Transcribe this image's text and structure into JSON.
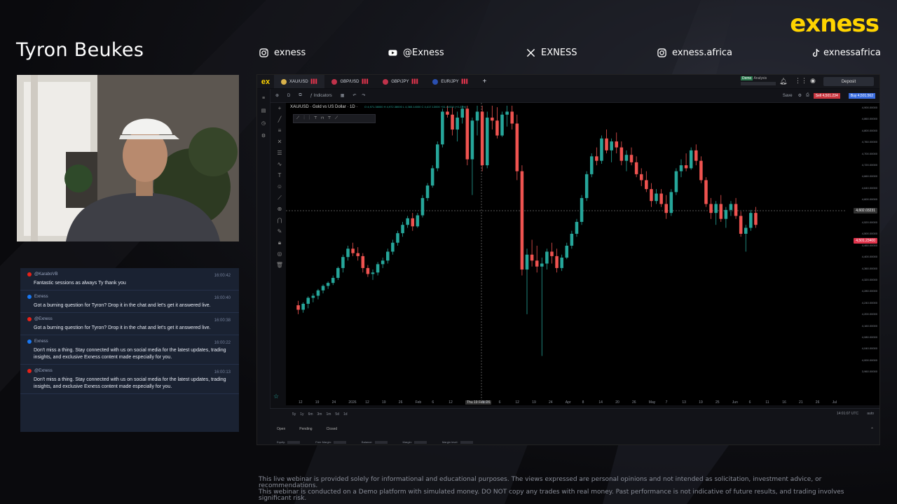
{
  "presenter_name": "Tyron Beukes",
  "brand": {
    "logo_text": "exness",
    "accent": "#ffd400"
  },
  "socials": [
    {
      "icon": "instagram-icon",
      "handle": "exness"
    },
    {
      "icon": "youtube-icon",
      "handle": "@Exness"
    },
    {
      "icon": "x-icon",
      "handle": "EXNESS"
    },
    {
      "icon": "instagram-icon",
      "handle": "exness.africa"
    },
    {
      "icon": "tiktok-icon",
      "handle": "exnessafrica"
    }
  ],
  "chat": [
    {
      "platform": "youtube",
      "user": "@KaraboVB",
      "time": "16:00:42",
      "text": "Fantastic sessions as always Ty thank you"
    },
    {
      "platform": "facebook",
      "user": "Exness",
      "time": "16:00:40",
      "text": "Got a burning question for Tyron? Drop it in the chat and let's get it answered live."
    },
    {
      "platform": "youtube",
      "user": "@Exness",
      "time": "16:00:38",
      "text": "Got a burning question for Tyron? Drop it in the chat and let's get it answered live."
    },
    {
      "platform": "facebook",
      "user": "Exness",
      "time": "16:00:22",
      "text": "Don't miss a thing. Stay connected with us on social media for the latest updates, trading insights, and exclusive Exness content made especially for you."
    },
    {
      "platform": "youtube",
      "user": "@Exness",
      "time": "16:00:13",
      "text": "Don't miss a thing. Stay connected with us on social media for the latest updates, trading insights, and exclusive Exness content made especially for you."
    }
  ],
  "terminal": {
    "logo": "ex",
    "tabs": [
      {
        "label": "XAU/USD",
        "active": true
      },
      {
        "label": "GBP/USD",
        "active": false
      },
      {
        "label": "GBP/JPY",
        "active": false
      },
      {
        "label": "EUR/JPY",
        "active": false
      }
    ],
    "add_tab": "+",
    "account_mode": "Demo",
    "account_type": "Analysis",
    "deposit_label": "Deposit",
    "toolbar_indicators": "Indicators",
    "save_label": "Save",
    "sell_label": "Sell 4,501.234",
    "buy_label": "Buy 4,501.562",
    "chart_title": "XAU/USD · Gold vs US Dollar · 1D ·",
    "ohlc": "O 4,971.38000  H 4,972.38000  L 4,365.14000  C 4,417.13000  +51.44000 (+0.23%)",
    "price_axis": [
      "4,900.00000",
      "4,860.00000",
      "4,800.00000",
      "4,760.00000",
      "4,700.00000",
      "4,720.00000",
      "4,660.00000",
      "4,640.00000",
      "4,600.00000",
      "4,580.00000",
      "4,520.00000",
      "4,500.00000",
      "4,460.00000",
      "4,400.00000",
      "4,360.00000",
      "4,320.00000",
      "4,280.00000",
      "4,240.00000",
      "4,200.00000",
      "4,160.00000",
      "4,080.00000",
      "4,040.00000",
      "4,000.00000",
      "3,960.00000"
    ],
    "crosshair_price": "4,602.03231",
    "current_price": "4,501.23400",
    "x_axis": [
      "12",
      "19",
      "24",
      "2026",
      "12",
      "19",
      "26",
      "Feb",
      "6",
      "12",
      "Thu 19 Feb '26",
      "Mar",
      "6",
      "12",
      "19",
      "24",
      "Apr",
      "8",
      "14",
      "20",
      "26",
      "May",
      "7",
      "13",
      "19",
      "25",
      "Jun",
      "6",
      "11",
      "16",
      "21",
      "26",
      "Jul"
    ],
    "timeframes": [
      "5y",
      "1y",
      "6m",
      "3m",
      "1m",
      "5d",
      "1d"
    ],
    "time_display": "14:01:07 UTC",
    "scale_mode": "auto",
    "bottom_tabs": [
      "Open",
      "Pending",
      "Closed"
    ],
    "account_fields": [
      "Equity:",
      "Free Margin:",
      "Balance:",
      "Margin:",
      "Margin level:"
    ],
    "colors": {
      "up": "#26a69a",
      "down": "#ef5350",
      "background": "#000000"
    }
  },
  "chart_data": {
    "type": "candlestick",
    "symbol": "XAU/USD",
    "interval": "1D",
    "ylim": [
      3960,
      4900
    ],
    "candles": [
      [
        4230,
        4245,
        4200,
        4215
      ],
      [
        4215,
        4240,
        4205,
        4235
      ],
      [
        4235,
        4260,
        4220,
        4255
      ],
      [
        4255,
        4270,
        4240,
        4262
      ],
      [
        4262,
        4285,
        4250,
        4280
      ],
      [
        4280,
        4300,
        4270,
        4295
      ],
      [
        4295,
        4310,
        4285,
        4305
      ],
      [
        4305,
        4330,
        4298,
        4322
      ],
      [
        4322,
        4360,
        4315,
        4355
      ],
      [
        4355,
        4400,
        4340,
        4392
      ],
      [
        4392,
        4430,
        4380,
        4420
      ],
      [
        4420,
        4440,
        4395,
        4405
      ],
      [
        4405,
        4425,
        4380,
        4395
      ],
      [
        4395,
        4405,
        4340,
        4355
      ],
      [
        4355,
        4365,
        4325,
        4335
      ],
      [
        4335,
        4350,
        4315,
        4340
      ],
      [
        4340,
        4375,
        4330,
        4368
      ],
      [
        4368,
        4390,
        4355,
        4380
      ],
      [
        4380,
        4420,
        4370,
        4410
      ],
      [
        4410,
        4450,
        4400,
        4440
      ],
      [
        4440,
        4480,
        4430,
        4472
      ],
      [
        4472,
        4510,
        4460,
        4500
      ],
      [
        4500,
        4530,
        4490,
        4522
      ],
      [
        4522,
        4540,
        4480,
        4495
      ],
      [
        4495,
        4540,
        4490,
        4532
      ],
      [
        4532,
        4600,
        4525,
        4590
      ],
      [
        4590,
        4640,
        4580,
        4632
      ],
      [
        4632,
        4700,
        4625,
        4690
      ],
      [
        4690,
        4780,
        4680,
        4770
      ],
      [
        4770,
        4890,
        4760,
        4880
      ],
      [
        4880,
        4900,
        4860,
        4870
      ],
      [
        4870,
        4895,
        4800,
        4820
      ],
      [
        4820,
        4880,
        4780,
        4860
      ],
      [
        4860,
        4900,
        4840,
        4890
      ],
      [
        4890,
        4900,
        4700,
        4720
      ],
      [
        4720,
        4860,
        4600,
        4850
      ],
      [
        4850,
        4900,
        4800,
        4880
      ],
      [
        4880,
        4900,
        4680,
        4700
      ],
      [
        4700,
        4880,
        4690,
        4860
      ],
      [
        4860,
        4900,
        4820,
        4850
      ],
      [
        4850,
        4895,
        4790,
        4800
      ],
      [
        4800,
        4880,
        4795,
        4870
      ],
      [
        4870,
        4900,
        4830,
        4880
      ],
      [
        4880,
        4900,
        4820,
        4840
      ],
      [
        4840,
        4870,
        4650,
        4680
      ],
      [
        4680,
        4700,
        4330,
        4350
      ],
      [
        4350,
        4420,
        4200,
        4400
      ],
      [
        4400,
        4450,
        4360,
        4380
      ],
      [
        4380,
        4430,
        4340,
        4360
      ],
      [
        4360,
        4390,
        4060,
        4370
      ],
      [
        4370,
        4420,
        4350,
        4410
      ],
      [
        4410,
        4440,
        4370,
        4395
      ],
      [
        4395,
        4420,
        4340,
        4355
      ],
      [
        4355,
        4400,
        4345,
        4390
      ],
      [
        4390,
        4440,
        4385,
        4430
      ],
      [
        4430,
        4480,
        4420,
        4470
      ],
      [
        4470,
        4520,
        4460,
        4510
      ],
      [
        4510,
        4600,
        4500,
        4590
      ],
      [
        4590,
        4680,
        4580,
        4670
      ],
      [
        4670,
        4740,
        4660,
        4730
      ],
      [
        4730,
        4760,
        4700,
        4715
      ],
      [
        4715,
        4800,
        4705,
        4790
      ],
      [
        4790,
        4820,
        4740,
        4750
      ],
      [
        4750,
        4790,
        4710,
        4780
      ],
      [
        4780,
        4810,
        4740,
        4760
      ],
      [
        4760,
        4780,
        4700,
        4715
      ],
      [
        4715,
        4750,
        4680,
        4735
      ],
      [
        4735,
        4760,
        4700,
        4710
      ],
      [
        4710,
        4730,
        4660,
        4670
      ],
      [
        4670,
        4690,
        4630,
        4650
      ],
      [
        4650,
        4680,
        4610,
        4620
      ],
      [
        4620,
        4640,
        4560,
        4580
      ],
      [
        4580,
        4620,
        4570,
        4605
      ],
      [
        4605,
        4620,
        4560,
        4570
      ],
      [
        4570,
        4600,
        4520,
        4540
      ],
      [
        4540,
        4620,
        4530,
        4610
      ],
      [
        4610,
        4690,
        4600,
        4680
      ],
      [
        4680,
        4720,
        4660,
        4700
      ],
      [
        4700,
        4740,
        4680,
        4690
      ],
      [
        4690,
        4760,
        4685,
        4750
      ],
      [
        4750,
        4770,
        4700,
        4715
      ],
      [
        4715,
        4730,
        4640,
        4650
      ],
      [
        4650,
        4660,
        4560,
        4570
      ],
      [
        4570,
        4590,
        4520,
        4540
      ],
      [
        4540,
        4580,
        4500,
        4570
      ],
      [
        4570,
        4600,
        4510,
        4520
      ],
      [
        4520,
        4560,
        4490,
        4550
      ],
      [
        4550,
        4580,
        4530,
        4570
      ],
      [
        4570,
        4590,
        4520,
        4530
      ],
      [
        4530,
        4545,
        4460,
        4470
      ],
      [
        4470,
        4500,
        4410,
        4490
      ],
      [
        4490,
        4550,
        4480,
        4540
      ],
      [
        4540,
        4560,
        4490,
        4500
      ]
    ]
  },
  "disclaimer_lines": [
    "This live webinar is provided solely for informational and educational purposes. The views expressed are personal opinions and not intended as solicitation, investment advice, or recommendations.",
    "This webinar is conducted on a Demo platform with simulated money. DO NOT copy any trades with real money. Past performance is not indicative of future results, and trading involves significant risk."
  ]
}
